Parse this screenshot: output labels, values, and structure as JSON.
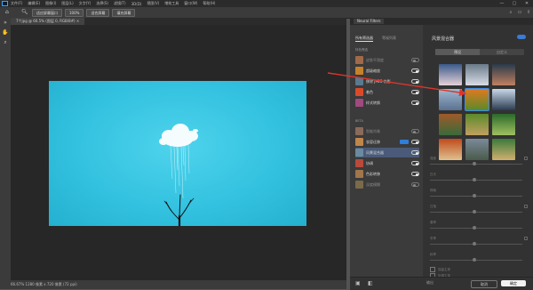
{
  "menubar": {
    "items": [
      "文件(F)",
      "编辑(E)",
      "图像(I)",
      "图层(L)",
      "文字(Y)",
      "选择(S)",
      "滤镜(T)",
      "3D(D)",
      "视图(V)",
      "增效工具",
      "窗口(W)",
      "帮助(H)"
    ],
    "min": "—",
    "max": "▢",
    "close": "✕"
  },
  "options": {
    "btn1": "适应屏幕窗口",
    "zoom": "100%",
    "btn2": "适合屏幕",
    "btn3": "填充屏幕"
  },
  "doc_tab": "7个jpg @ 66.5% (图层 0, RGB/8#) ×",
  "status": "66.67%   1280 像素 x 720 像素 (72 ppi)",
  "panel": {
    "title": "Neural Filters",
    "tab_all": "所有筛选器",
    "tab_wait": "等候列表",
    "sec_featured": "特色筛选",
    "sec_beta": "BETA",
    "featured": [
      {
        "label": "皮肤平滑度",
        "color": "#a06a4a",
        "on": false
      },
      {
        "label": "超级缩放",
        "color": "#c8812a",
        "on": true
      },
      {
        "label": "移除 JPEG 伪影",
        "color": "#5a7a90",
        "on": true
      },
      {
        "label": "着色",
        "color": "#d94a2a",
        "on": true
      },
      {
        "label": "样式转换",
        "color": "#a04a80",
        "on": true
      }
    ],
    "beta": [
      {
        "label": "智能肖像",
        "color": "#8a6a5a",
        "on": false,
        "badge": false,
        "sel": false
      },
      {
        "label": "妆容迁移",
        "color": "#c0864a",
        "on": true,
        "badge": true,
        "sel": false
      },
      {
        "label": "风景混合器",
        "color": "#6a8aa0",
        "on": true,
        "badge": false,
        "sel": true
      },
      {
        "label": "协调",
        "color": "#b84a3a",
        "on": true,
        "badge": false,
        "sel": false
      },
      {
        "label": "色彩转移",
        "color": "#a0764a",
        "on": true,
        "badge": false,
        "sel": false
      },
      {
        "label": "深度模糊",
        "color": "#7a6a4a",
        "on": false,
        "badge": false,
        "sel": false
      }
    ],
    "right_title": "风景混合器",
    "seg_left": "预设",
    "seg_right": "自定义",
    "thumbs": [
      {
        "c1": "#3a5a8a",
        "c2": "#e6d0d8"
      },
      {
        "c1": "#6a7a8a",
        "c2": "#d8dde6"
      },
      {
        "c1": "#2a3a4a",
        "c2": "#c08060"
      },
      {
        "c1": "#a0b8d0",
        "c2": "#5a7090"
      },
      {
        "c1": "#e07a20",
        "c2": "#5a8a2a"
      },
      {
        "c1": "#c8d8e8",
        "c2": "#2a3a50"
      },
      {
        "c1": "#a05a2a",
        "c2": "#3a6a3a"
      },
      {
        "c1": "#5a8a2a",
        "c2": "#c0a060"
      },
      {
        "c1": "#2a6a2a",
        "c2": "#a0c060"
      },
      {
        "c1": "#c04a1a",
        "c2": "#e0c090"
      },
      {
        "c1": "#7a8a9a",
        "c2": "#4a5a4a"
      },
      {
        "c1": "#3a7a3a",
        "c2": "#d0b070"
      }
    ],
    "sliders": [
      "强度",
      "白天",
      "夜晚",
      "日落",
      "春季",
      "冬季",
      "秋季"
    ],
    "check1": "保留主体",
    "check2": "协调主体",
    "output_label": "输出",
    "btn_cancel": "取消",
    "btn_ok": "确定"
  },
  "colors": {
    "accent": "#2f7fdc",
    "image_bg": "#33c2e0",
    "arrow": "#e0342a"
  }
}
